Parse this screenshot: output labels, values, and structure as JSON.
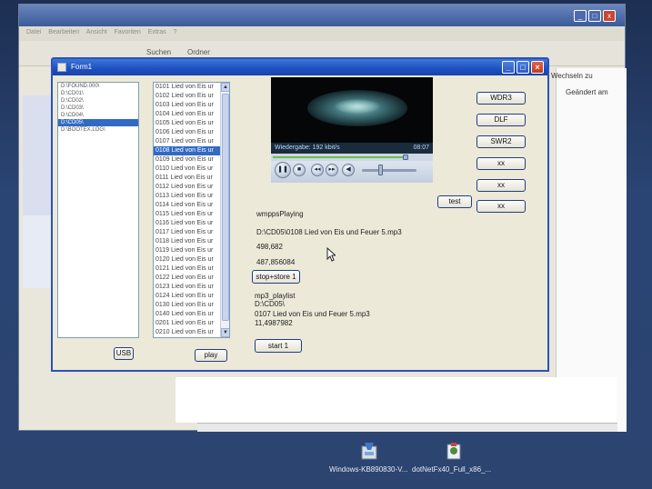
{
  "background_window": {
    "title": "",
    "menu": [
      "Datei",
      "Bearbeiten",
      "Ansicht",
      "Favoriten",
      "Extras",
      "?"
    ],
    "toolbar": {
      "search_label": "Suchen",
      "folders_label": "Ordner"
    },
    "right_panel": {
      "wechseln_label": "Wechseln zu",
      "changed_label": "Geändert am"
    }
  },
  "form": {
    "title": "Form1",
    "drive_list": [
      {
        "label": "D:\\FOUND.000\\",
        "selected": false
      },
      {
        "label": "D:\\CD01\\",
        "selected": false
      },
      {
        "label": "D:\\CD02\\",
        "selected": false
      },
      {
        "label": "D:\\CD03\\",
        "selected": false
      },
      {
        "label": "D:\\CD04\\",
        "selected": false
      },
      {
        "label": "D:\\CD05\\",
        "selected": true
      },
      {
        "label": "D:\\BOOTEX.LOG\\",
        "selected": false
      }
    ],
    "file_list": [
      {
        "label": "0101 Lied von Eis ur",
        "selected": false
      },
      {
        "label": "0102 Lied von Eis ur",
        "selected": false
      },
      {
        "label": "0103 Lied von Eis ur",
        "selected": false
      },
      {
        "label": "0104 Lied von Eis ur",
        "selected": false
      },
      {
        "label": "0105 Lied von Eis ur",
        "selected": false
      },
      {
        "label": "0106 Lied von Eis ur",
        "selected": false
      },
      {
        "label": "0107 Lied von Eis ur",
        "selected": false
      },
      {
        "label": "0108 Lied von Eis ur",
        "selected": true
      },
      {
        "label": "0109 Lied von Eis ur",
        "selected": false
      },
      {
        "label": "0110 Lied von Eis ur",
        "selected": false
      },
      {
        "label": "0111 Lied von Eis ur",
        "selected": false
      },
      {
        "label": "0112 Lied von Eis ur",
        "selected": false
      },
      {
        "label": "0113 Lied von Eis ur",
        "selected": false
      },
      {
        "label": "0114 Lied von Eis ur",
        "selected": false
      },
      {
        "label": "0115 Lied von Eis ur",
        "selected": false
      },
      {
        "label": "0116 Lied von Eis ur",
        "selected": false
      },
      {
        "label": "0117 Lied von Eis ur",
        "selected": false
      },
      {
        "label": "0118 Lied von Eis ur",
        "selected": false
      },
      {
        "label": "0119 Lied von Eis ur",
        "selected": false
      },
      {
        "label": "0120 Lied von Eis ur",
        "selected": false
      },
      {
        "label": "0121 Lied von Eis ur",
        "selected": false
      },
      {
        "label": "0122 Lied von Eis ur",
        "selected": false
      },
      {
        "label": "0123 Lied von Eis ur",
        "selected": false
      },
      {
        "label": "0124 Lied von Eis ur",
        "selected": false
      },
      {
        "label": "0130 Lied von Eis ur",
        "selected": false
      },
      {
        "label": "0140 Lied von Eis ur",
        "selected": false
      },
      {
        "label": "0201 Lied von Eis ur",
        "selected": false
      },
      {
        "label": "0210 Lied von Eis ur",
        "selected": false
      }
    ],
    "usb_button": "USB",
    "play_button": "play",
    "player": {
      "status": "Wiedergabe: 192 kbit/s",
      "time": "08:07",
      "progress": 0.85
    },
    "station_buttons": [
      "WDR3",
      "DLF",
      "SWR2",
      "xx",
      "xx",
      "xx"
    ],
    "test_button": "test",
    "state_label": "wmppsPlaying",
    "current_file": "D:\\CD05\\0108 Lied von Eis und Feuer 5.mp3",
    "position_value": "498,682",
    "duration_value": "487,856084",
    "stop_store_button": "stop+store 1",
    "playlist_label": "mp3_playlist",
    "playlist_dir": "D:\\CD05\\",
    "playlist_file": "0107 Lied von Eis und Feuer 5.mp3",
    "playlist_value": "11,4987982",
    "start_button": "start 1"
  },
  "desktop": {
    "icons": [
      {
        "label": "Windows-KB890830-V...",
        "icon": "installer-icon"
      },
      {
        "label": "dotNetFx40_Full_x86_...",
        "icon": "setup-icon"
      }
    ]
  },
  "colors": {
    "titlebar": "#1e4fc2",
    "selection": "#316ac5",
    "dialog": "#ece9d8"
  }
}
